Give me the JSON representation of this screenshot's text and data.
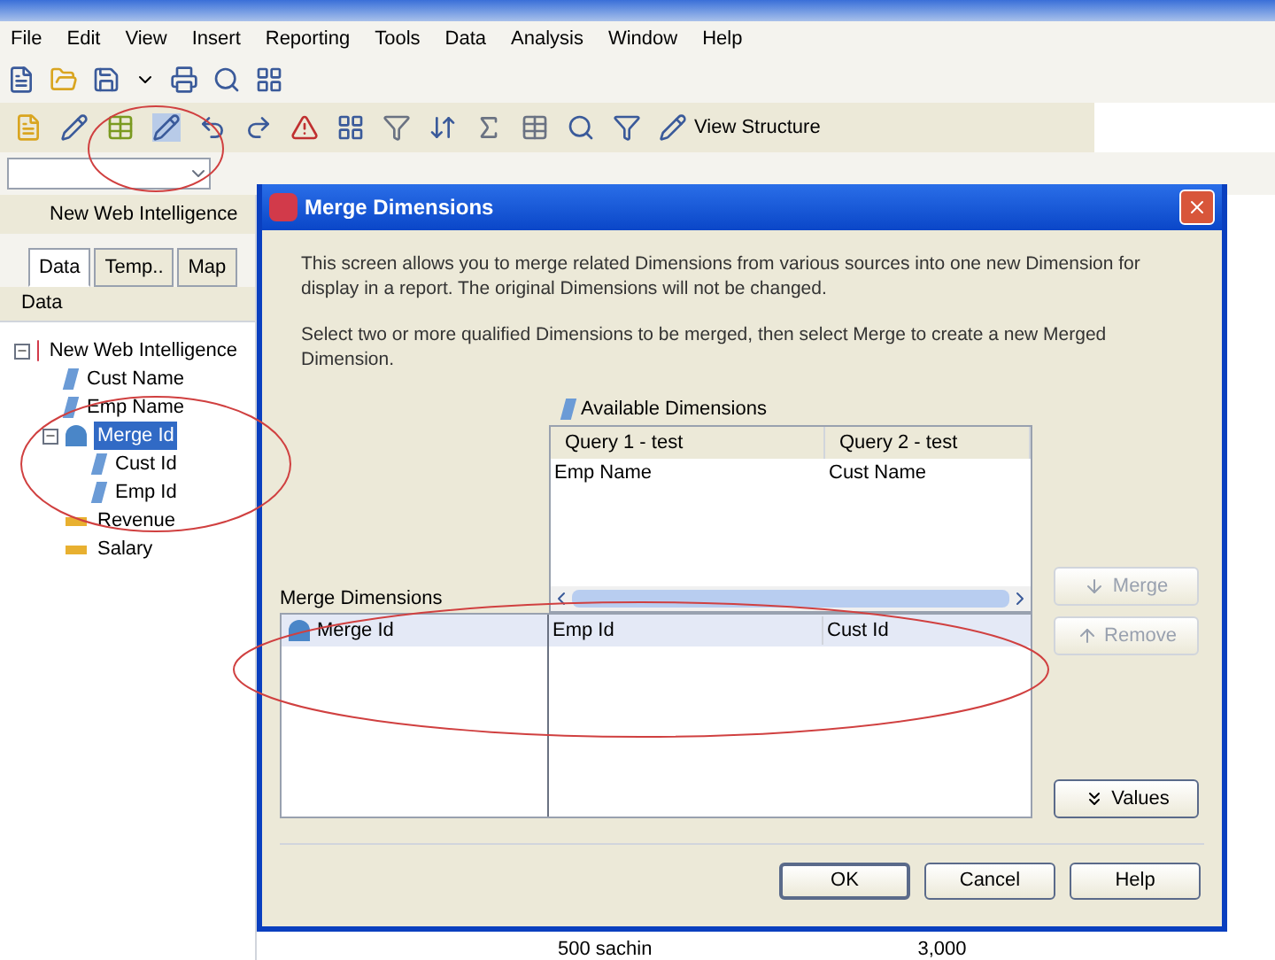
{
  "menu": [
    "File",
    "Edit",
    "View",
    "Insert",
    "Reporting",
    "Tools",
    "Data",
    "Analysis",
    "Window",
    "Help"
  ],
  "toolbar": {
    "view_structure": "View Structure"
  },
  "document_tab": "New Web Intelligence",
  "panel_tabs": [
    {
      "label": "Data",
      "selected": true
    },
    {
      "label": "Temp..",
      "selected": false
    },
    {
      "label": "Map",
      "selected": false
    }
  ],
  "panel_header": "Data",
  "tree": [
    {
      "label": "New Web Intelligence",
      "kind": "document",
      "expanded": true,
      "selected": false,
      "children": [
        {
          "label": "Cust Name",
          "kind": "dimension",
          "selected": false
        },
        {
          "label": "Emp Name",
          "kind": "dimension",
          "selected": false
        },
        {
          "label": "Merge Id",
          "kind": "merged",
          "expanded": true,
          "selected": true,
          "children": [
            {
              "label": "Cust Id",
              "kind": "dimension",
              "selected": false
            },
            {
              "label": "Emp Id",
              "kind": "dimension",
              "selected": false
            }
          ]
        },
        {
          "label": "Revenue",
          "kind": "measure",
          "selected": false
        },
        {
          "label": "Salary",
          "kind": "measure",
          "selected": false
        }
      ]
    }
  ],
  "report_cells": [
    "500 sachin",
    "3,000"
  ],
  "dialog": {
    "title": "Merge Dimensions",
    "description": [
      "This screen allows you to merge related Dimensions from various sources into one new Dimension for display in a report. The original Dimensions will not be changed.",
      "Select two or more qualified Dimensions to be merged, then select Merge to create a new Merged Dimension."
    ],
    "available_label": "Available Dimensions",
    "available": {
      "columns": [
        "Query 1 - test",
        "Query 2 - test"
      ],
      "rows": [
        [
          "Emp Name",
          "Cust Name"
        ]
      ]
    },
    "merged_label": "Merge Dimensions",
    "merged": [
      {
        "name": "Merge Id",
        "sources": [
          "Emp Id",
          "Cust Id"
        ],
        "selected": true
      }
    ],
    "side_buttons": [
      {
        "label": "Merge",
        "kind": "down",
        "disabled": true
      },
      {
        "label": "Remove",
        "kind": "up",
        "disabled": true
      }
    ],
    "values_button": "Values",
    "buttons": [
      {
        "label": "OK",
        "default": true
      },
      {
        "label": "Cancel",
        "default": false
      },
      {
        "label": "Help",
        "default": false
      }
    ]
  }
}
